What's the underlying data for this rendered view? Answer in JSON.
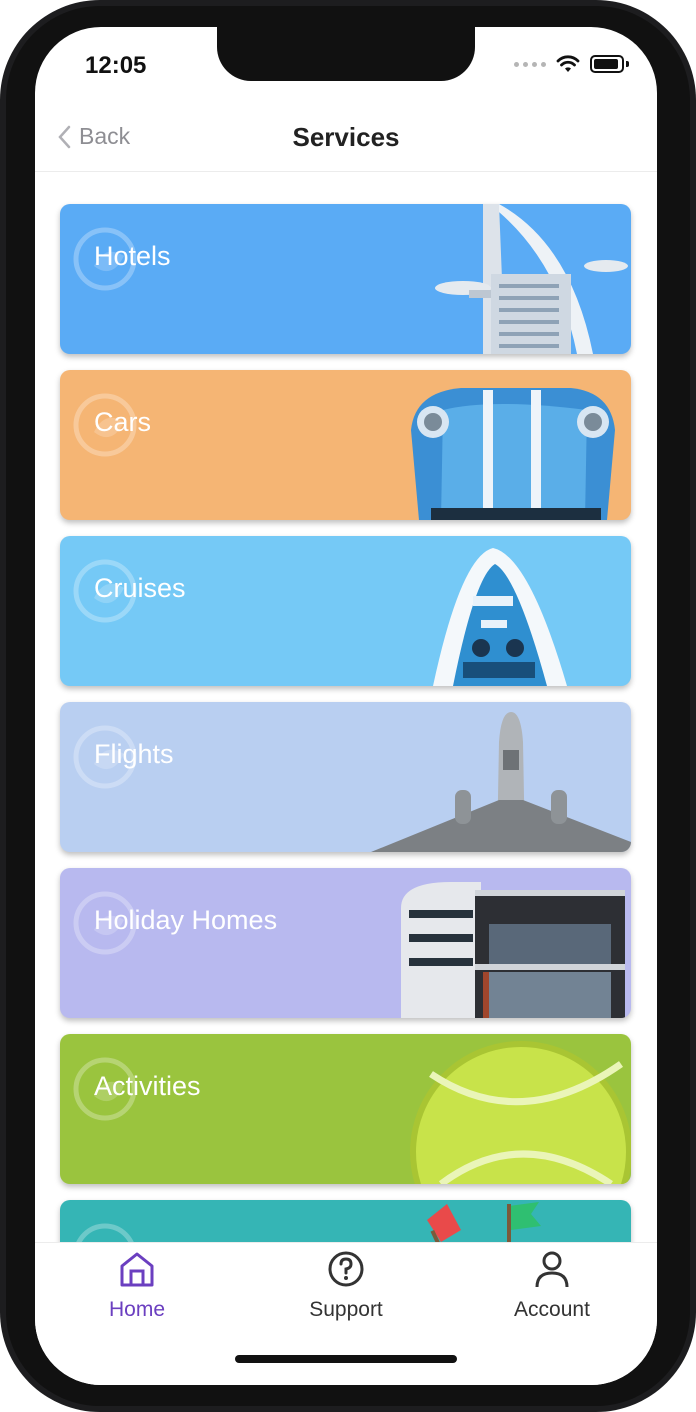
{
  "status_bar": {
    "time": "12:05"
  },
  "navbar": {
    "back_label": "Back",
    "title": "Services"
  },
  "services": [
    {
      "label": "Hotels",
      "color": "#5aabf5"
    },
    {
      "label": "Cars",
      "color": "#f5b574"
    },
    {
      "label": "Cruises",
      "color": "#75c9f6"
    },
    {
      "label": "Flights",
      "color": "#b9cff1"
    },
    {
      "label": "Holiday Homes",
      "color": "#b8b9ef"
    },
    {
      "label": "Activities",
      "color": "#9ac43e"
    },
    {
      "label": "",
      "color": "#35b5b5"
    }
  ],
  "tabbar": {
    "home": {
      "label": "Home",
      "color": "#6b3fc0",
      "active": true
    },
    "support": {
      "label": "Support",
      "color": "#333333"
    },
    "account": {
      "label": "Account",
      "color": "#333333"
    }
  }
}
